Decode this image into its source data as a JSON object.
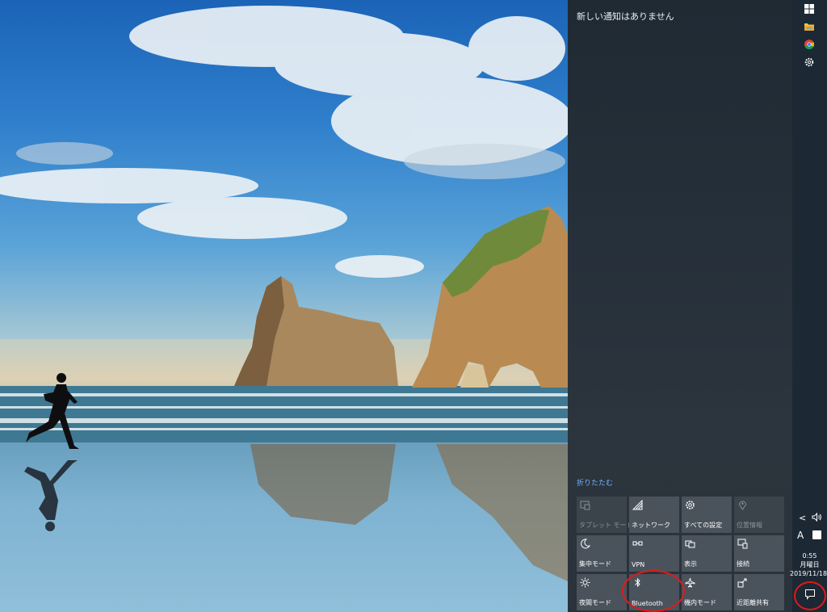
{
  "action_center": {
    "no_notifications": "新しい通知はありません",
    "collapse": "折りたたむ",
    "tiles": [
      {
        "label": "タブレット モード",
        "icon": "tablet-mode-icon",
        "state": "off"
      },
      {
        "label": "ネットワーク",
        "icon": "network-icon",
        "state": "on"
      },
      {
        "label": "すべての設定",
        "icon": "settings-icon",
        "state": "on"
      },
      {
        "label": "位置情報",
        "icon": "location-icon",
        "state": "off"
      },
      {
        "label": "集中モード",
        "icon": "focus-assist-icon",
        "state": "on"
      },
      {
        "label": "VPN",
        "icon": "vpn-icon",
        "state": "on"
      },
      {
        "label": "表示",
        "icon": "project-icon",
        "state": "on"
      },
      {
        "label": "接続",
        "icon": "connect-icon",
        "state": "on"
      },
      {
        "label": "夜間モード",
        "icon": "night-light-icon",
        "state": "on"
      },
      {
        "label": "Bluetooth",
        "icon": "bluetooth-icon",
        "state": "on",
        "highlighted": true
      },
      {
        "label": "機内モード",
        "icon": "airplane-mode-icon",
        "state": "on"
      },
      {
        "label": "近距離共有",
        "icon": "nearby-sharing-icon",
        "state": "on"
      }
    ]
  },
  "taskbar": {
    "icons": [
      "windows-start-icon",
      "file-explorer-icon",
      "chrome-icon",
      "settings-gear-icon"
    ],
    "tray": {
      "chevron": "<",
      "ime": "A"
    },
    "clock": {
      "time": "0:55",
      "weekday": "月曜日",
      "date": "2019/11/18"
    }
  },
  "colors": {
    "accent_link": "#6fb4ff",
    "highlight_ring": "#e01a1a",
    "tile_on": "#4a535c",
    "tile_off": "#3b434b"
  }
}
